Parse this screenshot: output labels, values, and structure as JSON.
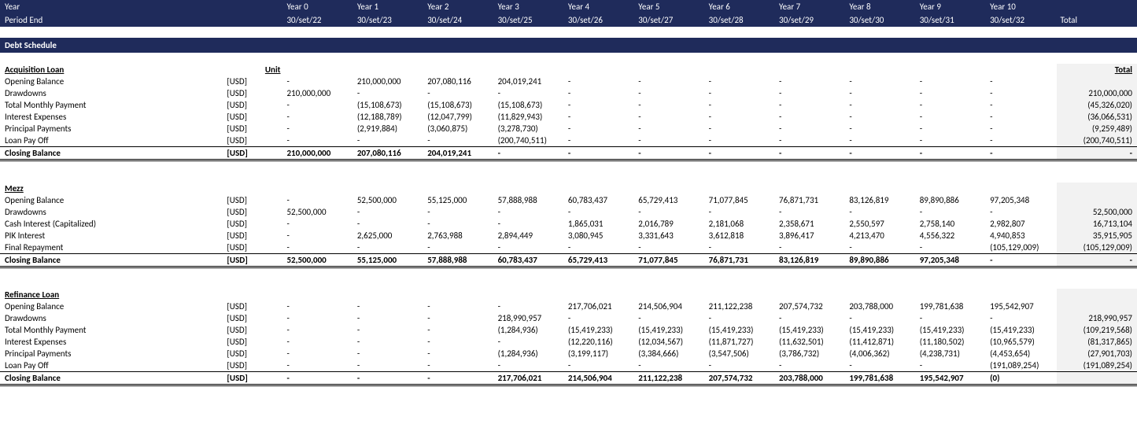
{
  "header": {
    "row1_label": "Year",
    "years": [
      "Year 0",
      "Year 1",
      "Year 2",
      "Year 3",
      "Year 4",
      "Year 5",
      "Year 6",
      "Year 7",
      "Year 8",
      "Year 9",
      "Year 10"
    ],
    "row2_label": "Period End",
    "dates": [
      "30/set/22",
      "30/set/23",
      "30/set/24",
      "30/set/25",
      "30/set/26",
      "30/set/27",
      "30/set/28",
      "30/set/29",
      "30/set/30",
      "30/set/31",
      "30/set/32"
    ],
    "total_label": "Total"
  },
  "section_title": "Debt Schedule",
  "unit_header": "Unit",
  "unit": "[USD]",
  "total_header": "Total",
  "acquisition": {
    "title": "Acquisition Loan",
    "rows": {
      "opening": {
        "label": "Opening Balance",
        "v": [
          "-",
          "210,000,000",
          "207,080,116",
          "204,019,241",
          "-",
          "-",
          "-",
          "-",
          "-",
          "-",
          "-"
        ],
        "t": ""
      },
      "drawdowns": {
        "label": "Drawdowns",
        "v": [
          "210,000,000",
          "-",
          "-",
          "-",
          "-",
          "-",
          "-",
          "-",
          "-",
          "-",
          "-"
        ],
        "t": "210,000,000"
      },
      "tmp": {
        "label": "Total Monthly Payment",
        "v": [
          "-",
          "(15,108,673)",
          "(15,108,673)",
          "(15,108,673)",
          "-",
          "-",
          "-",
          "-",
          "-",
          "-",
          "-"
        ],
        "t": "(45,326,020)"
      },
      "ie": {
        "label": "Interest Expenses",
        "v": [
          "-",
          "(12,188,789)",
          "(12,047,799)",
          "(11,829,943)",
          "-",
          "-",
          "-",
          "-",
          "-",
          "-",
          "-"
        ],
        "t": "(36,066,531)"
      },
      "pp": {
        "label": "Principal Payments",
        "v": [
          "-",
          "(2,919,884)",
          "(3,060,875)",
          "(3,278,730)",
          "-",
          "-",
          "-",
          "-",
          "-",
          "-",
          "-"
        ],
        "t": "(9,259,489)"
      },
      "lpo": {
        "label": "Loan Pay Off",
        "v": [
          "-",
          "-",
          "-",
          "(200,740,511)",
          "-",
          "-",
          "-",
          "-",
          "-",
          "-",
          "-"
        ],
        "t": "(200,740,511)"
      },
      "closing": {
        "label": "Closing Balance",
        "v": [
          "210,000,000",
          "207,080,116",
          "204,019,241",
          "-",
          "-",
          "-",
          "-",
          "-",
          "-",
          "-",
          "-"
        ],
        "t": "-"
      }
    }
  },
  "mezz": {
    "title": "Mezz",
    "rows": {
      "opening": {
        "label": "Opening Balance",
        "v": [
          "-",
          "52,500,000",
          "55,125,000",
          "57,888,988",
          "60,783,437",
          "65,729,413",
          "71,077,845",
          "76,871,731",
          "83,126,819",
          "89,890,886",
          "97,205,348"
        ],
        "t": ""
      },
      "drawdowns": {
        "label": "Drawdowns",
        "v": [
          "52,500,000",
          "-",
          "-",
          "-",
          "-",
          "-",
          "-",
          "-",
          "-",
          "-",
          "-"
        ],
        "t": "52,500,000"
      },
      "cic": {
        "label": "Cash Interest (Capitalized)",
        "v": [
          "-",
          "-",
          "-",
          "-",
          "1,865,031",
          "2,016,789",
          "2,181,068",
          "2,358,671",
          "2,550,597",
          "2,758,140",
          "2,982,807"
        ],
        "t": "16,713,104"
      },
      "pik": {
        "label": "PIK Interest",
        "v": [
          "-",
          "2,625,000",
          "2,763,988",
          "2,894,449",
          "3,080,945",
          "3,331,643",
          "3,612,818",
          "3,896,417",
          "4,213,470",
          "4,556,322",
          "4,940,853"
        ],
        "t": "35,915,905"
      },
      "fr": {
        "label": "Final Repayment",
        "v": [
          "-",
          "-",
          "-",
          "-",
          "-",
          "-",
          "-",
          "-",
          "-",
          "-",
          "(105,129,009)"
        ],
        "t": "(105,129,009)"
      },
      "closing": {
        "label": "Closing Balance",
        "v": [
          "52,500,000",
          "55,125,000",
          "57,888,988",
          "60,783,437",
          "65,729,413",
          "71,077,845",
          "76,871,731",
          "83,126,819",
          "89,890,886",
          "97,205,348",
          "-"
        ],
        "t": "-"
      }
    }
  },
  "refinance": {
    "title": "Refinance Loan",
    "rows": {
      "opening": {
        "label": "Opening Balance",
        "v": [
          "-",
          "-",
          "-",
          "-",
          "217,706,021",
          "214,506,904",
          "211,122,238",
          "207,574,732",
          "203,788,000",
          "199,781,638",
          "195,542,907"
        ],
        "t": ""
      },
      "drawdowns": {
        "label": "Drawdowns",
        "v": [
          "-",
          "-",
          "-",
          "218,990,957",
          "-",
          "-",
          "-",
          "-",
          "-",
          "-",
          "-"
        ],
        "t": "218,990,957"
      },
      "tmp": {
        "label": "Total Monthly Payment",
        "v": [
          "-",
          "-",
          "-",
          "(1,284,936)",
          "(15,419,233)",
          "(15,419,233)",
          "(15,419,233)",
          "(15,419,233)",
          "(15,419,233)",
          "(15,419,233)",
          "(15,419,233)"
        ],
        "t": "(109,219,568)"
      },
      "ie": {
        "label": "Interest Expenses",
        "v": [
          "-",
          "-",
          "-",
          "-",
          "(12,220,116)",
          "(12,034,567)",
          "(11,871,727)",
          "(11,632,501)",
          "(11,412,871)",
          "(11,180,502)",
          "(10,965,579)"
        ],
        "t": "(81,317,865)"
      },
      "pp": {
        "label": "Principal Payments",
        "v": [
          "-",
          "-",
          "-",
          "(1,284,936)",
          "(3,199,117)",
          "(3,384,666)",
          "(3,547,506)",
          "(3,786,732)",
          "(4,006,362)",
          "(4,238,731)",
          "(4,453,654)"
        ],
        "t": "(27,901,703)"
      },
      "lpo": {
        "label": "Loan Pay Off",
        "v": [
          "-",
          "-",
          "-",
          "-",
          "-",
          "-",
          "-",
          "-",
          "-",
          "-",
          "(191,089,254)"
        ],
        "t": "(191,089,254)"
      },
      "closing": {
        "label": "Closing Balance",
        "v": [
          "-",
          "-",
          "-",
          "217,706,021",
          "214,506,904",
          "211,122,238",
          "207,574,732",
          "203,788,000",
          "199,781,638",
          "195,542,907",
          "(0)"
        ],
        "t": ""
      }
    }
  }
}
